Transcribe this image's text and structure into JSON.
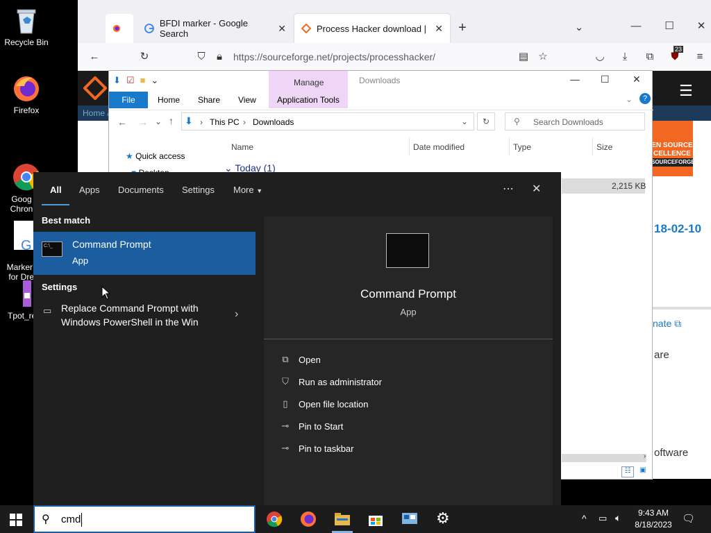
{
  "desktop": {
    "icons": [
      {
        "label": "Recycle Bin"
      },
      {
        "label": "Firefox"
      },
      {
        "label": "Goog\nChron"
      },
      {
        "label": "Marker E\nfor Drea"
      },
      {
        "label": "Tpot_ren"
      }
    ]
  },
  "browser": {
    "tabs": [
      {
        "label": "BFDI marker - Google Search"
      },
      {
        "label": "Process Hacker download | So"
      }
    ],
    "url": "https://sourceforge.net/projects/processhacker/",
    "badge_count": "23",
    "page": {
      "home_link": "Home /",
      "badge_line1": "EN SOURCE",
      "badge_line2": "CELLENCE",
      "badge_line3": "SOURCEFORGE",
      "date_fragment": "18-02-10",
      "link_fragment": "nate",
      "text_fragment1": "are",
      "text_fragment2": "oftware"
    }
  },
  "explorer": {
    "title": "Downloads",
    "manage_label": "Manage",
    "tabs": [
      "File",
      "Home",
      "Share",
      "View",
      "Application Tools"
    ],
    "breadcrumb": [
      "This PC",
      "Downloads"
    ],
    "search_placeholder": "Search Downloads",
    "columns": [
      "Name",
      "Date modified",
      "Type",
      "Size"
    ],
    "nav_quick_access": "Quick access",
    "nav_desktop": "Desktop",
    "group_today": "Today (1)",
    "file_size": "2,215 KB"
  },
  "search": {
    "filters": [
      "All",
      "Apps",
      "Documents",
      "Settings",
      "More"
    ],
    "best_match_heading": "Best match",
    "best_match": {
      "title": "Command Prompt",
      "subtitle": "App"
    },
    "settings_heading": "Settings",
    "settings_item_line1": "Replace Command Prompt with",
    "settings_item_line2": "Windows PowerShell in the Win",
    "preview": {
      "title": "Command Prompt",
      "subtitle": "App"
    },
    "actions": [
      "Open",
      "Run as administrator",
      "Open file location",
      "Pin to Start",
      "Pin to taskbar"
    ],
    "query": "cmd"
  },
  "taskbar": {
    "time": "9:43 AM",
    "date": "8/18/2023"
  },
  "colors": {
    "accent_blue": "#1c5da0",
    "explorer_file_tab": "#1979ca",
    "manage_tab": "#efd6f7",
    "sf_orange": "#f26722"
  }
}
